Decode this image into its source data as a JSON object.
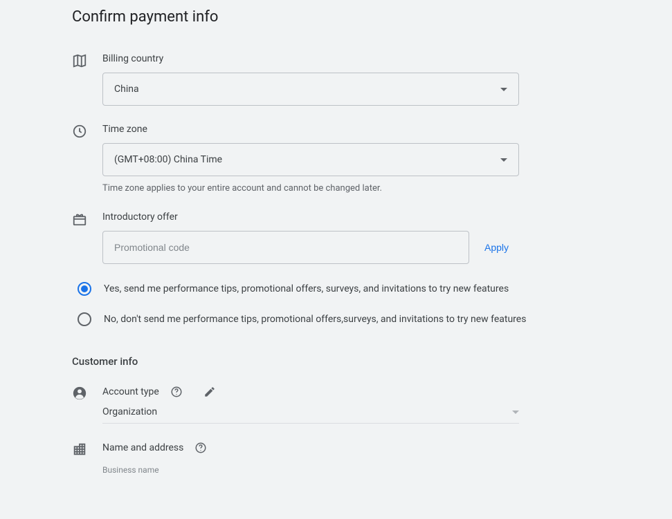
{
  "page_title": "Confirm payment info",
  "billing_country": {
    "label": "Billing country",
    "value": "China"
  },
  "time_zone": {
    "label": "Time zone",
    "value": "(GMT+08:00) China Time",
    "hint": "Time zone applies to your entire account and cannot be changed later."
  },
  "intro_offer": {
    "label": "Introductory offer",
    "placeholder": "Promotional code",
    "apply_label": "Apply"
  },
  "marketing_opt": {
    "yes": "Yes, send me performance tips, promotional offers, surveys, and invitations to try new features",
    "no": "No, don't send me performance tips, promotional offers,surveys, and invitations to try new features"
  },
  "customer_info": {
    "heading": "Customer info",
    "account_type_label": "Account type",
    "account_type_value": "Organization",
    "name_address_label": "Name and address",
    "business_name_label": "Business name"
  }
}
